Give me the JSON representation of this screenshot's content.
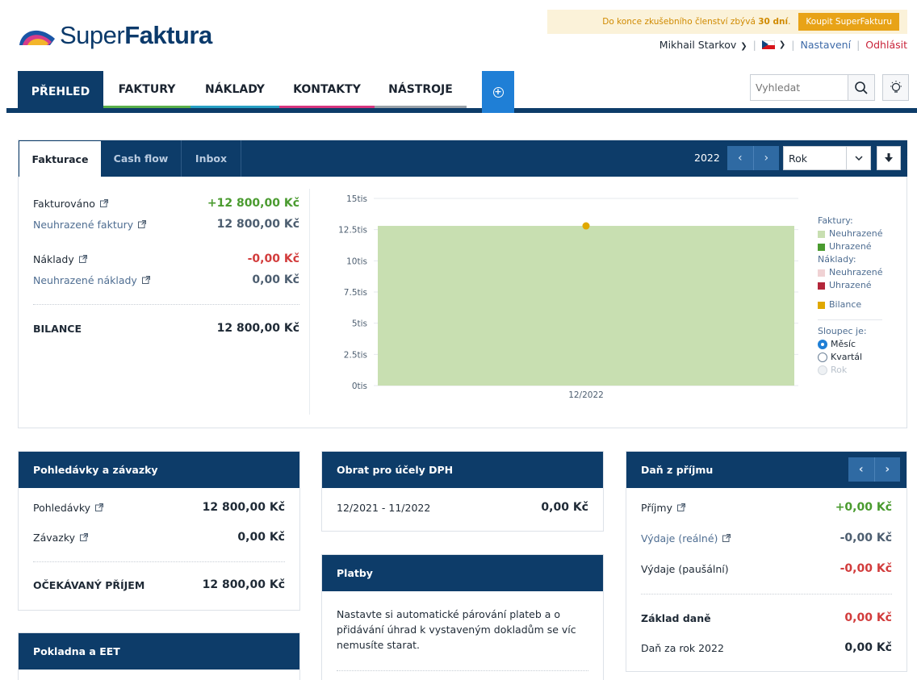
{
  "brand": {
    "word_light": "Super",
    "word_bold": "Faktura"
  },
  "trial": {
    "text_prefix": "Do konce zkušebního členství zbývá ",
    "days": "30 dní",
    "text_suffix": ".",
    "buy_label": "Koupit SuperFakturu"
  },
  "user": {
    "name": "Mikhail Starkov",
    "settings": "Nastavení",
    "logout": "Odhlásit"
  },
  "nav": {
    "items": [
      {
        "label": "PŘEHLED",
        "color": "#0d3c69"
      },
      {
        "label": "FAKTURY",
        "color": "#5bb04a"
      },
      {
        "label": "NÁKLADY",
        "color": "#27a0c4"
      },
      {
        "label": "KONTAKTY",
        "color": "#d6357e"
      },
      {
        "label": "NÁSTROJE",
        "color": "#9aa1a8"
      }
    ],
    "search_placeholder": "Vyhledat"
  },
  "dashboard": {
    "tabs": [
      "Fakturace",
      "Cash flow",
      "Inbox"
    ],
    "year": "2022",
    "period": "Rok",
    "stats": {
      "invoiced_label": "Fakturováno",
      "invoiced_value": "+12 800,00 Kč",
      "unpaid_invoices_label": "Neuhrazené faktury",
      "unpaid_invoices_value": "12 800,00 Kč",
      "costs_label": "Náklady",
      "costs_value": "-0,00 Kč",
      "unpaid_costs_label": "Neuhrazené náklady",
      "unpaid_costs_value": "0,00 Kč",
      "balance_label": "BILANCE",
      "balance_value": "12 800,00 Kč"
    },
    "legend": {
      "invoices_title": "Faktury:",
      "unpaid": "Neuhrazené",
      "paid": "Uhrazené",
      "costs_title": "Náklady:",
      "cost_unpaid": "Neuhrazené",
      "cost_paid": "Uhrazené",
      "balance": "Bilance",
      "column_title": "Sloupec je:",
      "opt_month": "Měsíc",
      "opt_quarter": "Kvartál",
      "opt_year": "Rok"
    }
  },
  "chart_data": {
    "type": "bar",
    "categories": [
      "12/2022"
    ],
    "series": [
      {
        "name": "Neuhrazené",
        "values": [
          12800
        ],
        "color": "#c8dfb1"
      },
      {
        "name": "Bilance",
        "values": [
          12800
        ],
        "color": "#e0a800"
      }
    ],
    "yticks": [
      "0tis",
      "2.5tis",
      "5tis",
      "7.5tis",
      "10tis",
      "12.5tis",
      "15tis"
    ],
    "ylim": [
      0,
      15000
    ]
  },
  "receivables": {
    "title": "Pohledávky a závazky",
    "receivables_label": "Pohledávky",
    "receivables_value": "12 800,00 Kč",
    "payables_label": "Závazky",
    "payables_value": "0,00 Kč",
    "expected_label": "OČEKÁVANÝ PŘÍJEM",
    "expected_value": "12 800,00 Kč"
  },
  "cash": {
    "title": "Pokladna a EET"
  },
  "vat": {
    "title": "Obrat pro účely DPH",
    "period": "12/2021 - 11/2022",
    "value": "0,00 Kč"
  },
  "payments": {
    "title": "Platby",
    "text": "Nastavte si automatické párování plateb a o přidávání úhrad k vystaveným dokladům se víc nemusíte starat."
  },
  "tax": {
    "title": "Daň z příjmu",
    "income_label": "Příjmy",
    "income_value": "+0,00 Kč",
    "real_exp_label": "Výdaje (reálné)",
    "real_exp_value": "-0,00 Kč",
    "flat_exp_label": "Výdaje (paušální)",
    "flat_exp_value": "-0,00 Kč",
    "base_label": "Základ daně",
    "base_value": "0,00 Kč",
    "tax_label": "Daň za rok 2022",
    "tax_value": "0,00 Kč"
  }
}
